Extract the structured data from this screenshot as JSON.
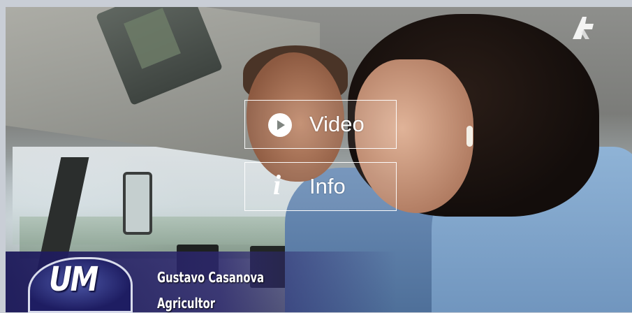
{
  "thumbnail": {
    "channel_logo_icon": "channel-logo-icon",
    "lower_third": {
      "badge_text": "UM",
      "name": "Gustavo Casanova",
      "role": "Agricultor"
    }
  },
  "overlay": {
    "video_button": {
      "label": "Video",
      "icon": "play-icon"
    },
    "info_button": {
      "label": "Info",
      "icon": "info-icon"
    }
  },
  "colors": {
    "lower_third_bg": "#1c195a",
    "button_border": "#ffffff",
    "background": "#c9ced6"
  }
}
